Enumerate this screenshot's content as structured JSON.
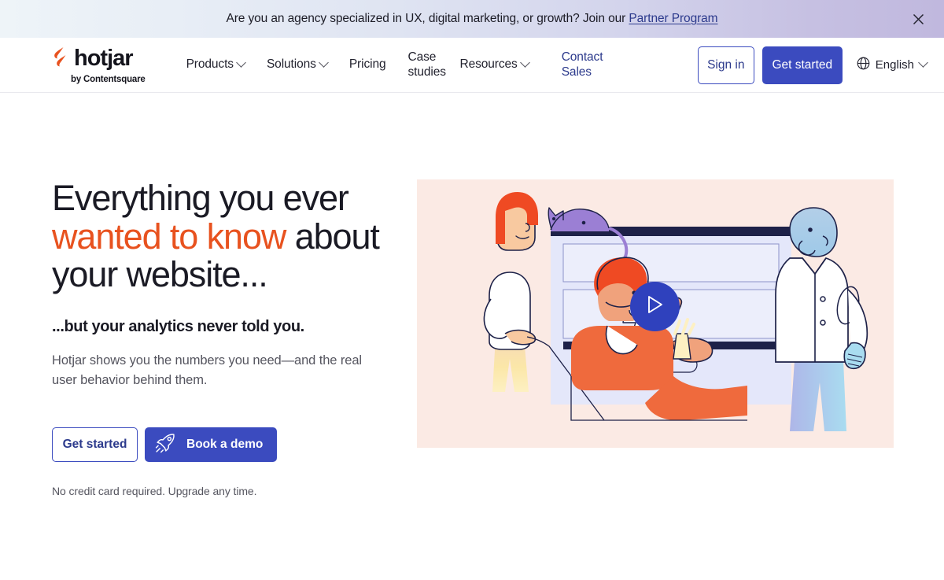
{
  "banner": {
    "text_before": "Are you an agency specialized in UX, digital marketing, or growth? Join our ",
    "link_label": "Partner Program",
    "close_icon": "close-icon"
  },
  "header": {
    "logo": {
      "wordmark": "hotjar",
      "tagline": "by Contentsquare",
      "mark_color": "#e8521f"
    },
    "nav": [
      {
        "label": "Products",
        "has_chevron": true
      },
      {
        "label": "Solutions",
        "has_chevron": true
      },
      {
        "label": "Pricing",
        "has_chevron": false
      },
      {
        "label": "Case studies",
        "has_chevron": false
      },
      {
        "label": "Resources",
        "has_chevron": true
      }
    ],
    "contact_sales": "Contact Sales",
    "sign_in": "Sign in",
    "get_started": "Get started",
    "language": {
      "label": "English",
      "icon": "globe-icon"
    }
  },
  "hero": {
    "headline_part1": "Everything you ever ",
    "headline_accent": "wanted to know",
    "headline_part2": " about your website...",
    "subheading": "...but your analytics never told you.",
    "body": "Hotjar shows you the numbers you need—and the real user behavior behind them.",
    "cta_primary": "Get started",
    "cta_secondary": "Book a demo",
    "cta_secondary_icon": "rocket-icon",
    "fineprint": "No credit card required. Upgrade any time.",
    "illustration": {
      "alt": "People interacting with a website interface",
      "background_color": "#fbeae4",
      "play_button_icon": "play-icon",
      "play_button_color": "#2f41bd"
    }
  },
  "colors": {
    "brand_orange": "#e8521f",
    "brand_indigo": "#3b4bbf",
    "link_indigo": "#2c3a8c",
    "text_dark": "#1a1a24",
    "text_muted": "#55555f"
  }
}
